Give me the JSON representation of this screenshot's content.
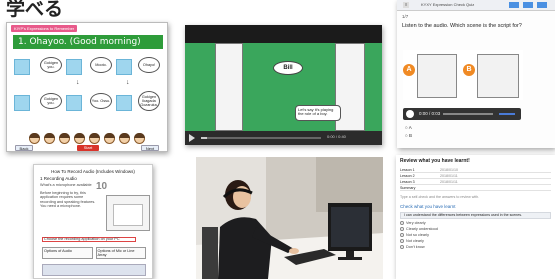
{
  "heading": "学べる",
  "lesson_slide": {
    "tabs": [
      "",
      "",
      ""
    ],
    "title": "1. Ohayoo. (Good morning)",
    "subtitle": "KIYP's Expressions to Remember",
    "bubbles": [
      "Gokigen you.",
      "Mooto.",
      "Ohayo!",
      "Gokigen you.",
      "Yoo. Ossu.",
      "Gokigen Ikagada Gozaruka."
    ],
    "buttons": [
      "Back",
      "Start",
      "Next"
    ]
  },
  "video": {
    "speech": "Bill",
    "caption": "Let's say it's playing the role of a boy.",
    "time": "0:00 / 0:40",
    "progress": 0.05
  },
  "quiz": {
    "window_title": "KYXY Expression Check Quiz",
    "question_number": "1/7",
    "prompt": "Listen to the audio. Which scene is the script for?",
    "options": [
      "A",
      "B"
    ],
    "player_time": "0:00 / 0:03"
  },
  "guide": {
    "title": "How To Record Audio (Includes Windows)",
    "section": "1 Recording Audio",
    "logo": "10",
    "para1": "What's a microphone available",
    "para2": "Before beginning to try, this application requires some recording and speaking features. You need a microphone.",
    "highlight": "Choose the recording application on your PC",
    "box1": "Options of Audio",
    "box2": "Options of Mic or Line Array"
  },
  "review": {
    "heading": "Review what you have learnt!",
    "rows": [
      {
        "label": "Lesson 1",
        "value": "2018/01/10"
      },
      {
        "label": "Lesson 2",
        "value": "2018/01/11"
      },
      {
        "label": "Lesson 3",
        "value": "2018/01/11"
      },
      {
        "label": "Summary",
        "value": ""
      }
    ],
    "note": "Type a self-check and the answers to review with.",
    "subheading": "Check what you have learnt",
    "bar": "I can understand the differences between expressions used in the scenes.",
    "radios": [
      "Very clearly",
      "Clearly understood",
      "Not so clearly",
      "Not clearly",
      "Don't know"
    ]
  }
}
